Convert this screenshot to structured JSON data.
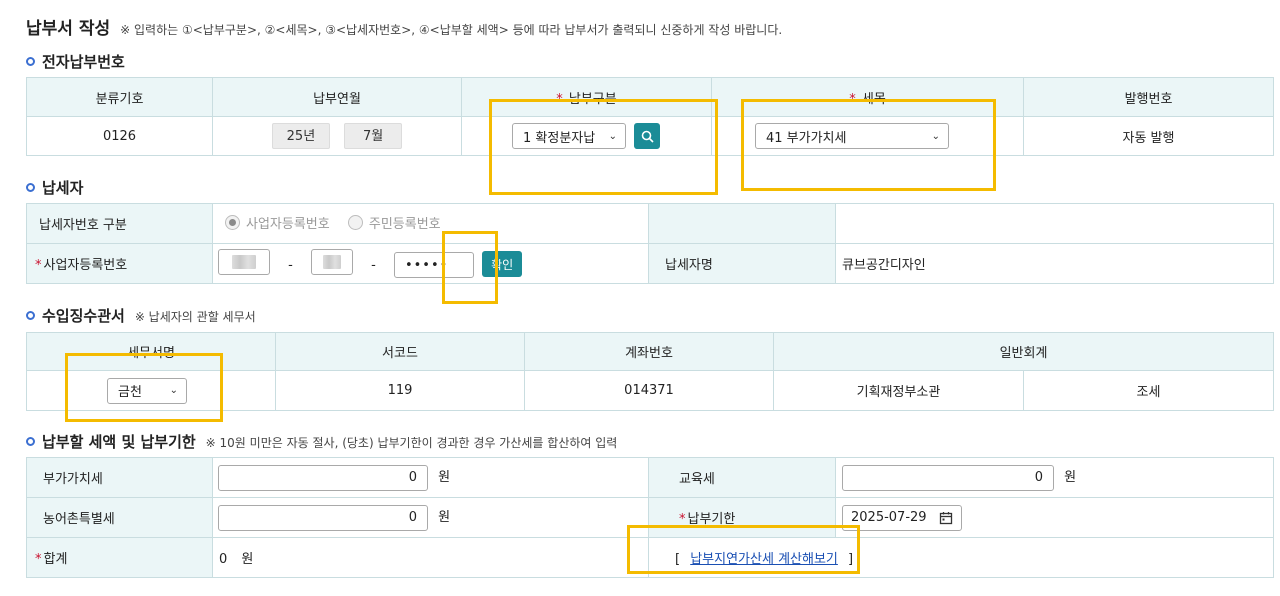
{
  "page": {
    "title": "납부서 작성",
    "note": "※ 입력하는 ①<납부구분>, ②<세목>, ③<납세자번호>, ④<납부할 세액> 등에 따라 납부서가 출력되니 신중하게 작성 바랍니다."
  },
  "electronic": {
    "section_title": "전자납부번호",
    "headers": [
      "분류기호",
      "납부연월",
      "납부구분",
      "세목",
      "발행번호"
    ],
    "class_code": "0126",
    "year": "25년",
    "month": "7월",
    "payment_type": "1 확정분자납",
    "tax_item": "41 부가가치세",
    "issue_no": "자동 발행"
  },
  "taxpayer": {
    "section_title": "납세자",
    "type_label": "납세자번호 구분",
    "radio_business": "사업자등록번호",
    "radio_resident": "주민등록번호",
    "brn_label": "사업자등록번호",
    "dash": "-",
    "masked": "•••••",
    "confirm_btn": "확인",
    "name_label": "납세자명",
    "name_value": "큐브공간디자인"
  },
  "office": {
    "section_title": "수입징수관서",
    "note": "※ 납세자의 관할 세무서",
    "headers": [
      "세무서명",
      "서코드",
      "계좌번호",
      "일반회계"
    ],
    "office_name": "금천",
    "office_code": "119",
    "account": "014371",
    "ministry": "기획재정부소관",
    "tax": "조세"
  },
  "amount": {
    "section_title": "납부할 세액 및 납부기한",
    "note": "※ 10원 미만은 자동 절사, (당초) 납부기한이 경과한 경우 가산세를 합산하여 입력",
    "vat_label": "부가가치세",
    "vat_value": "0",
    "edu_label": "교육세",
    "edu_value": "0",
    "rural_label": "농어촌특별세",
    "rural_value": "0",
    "due_label": "납부기한",
    "due_value": "2025-07-29",
    "total_label": "합계",
    "total_value": "0",
    "won": "원",
    "calc_link": "납부지연가산세 계산해보기",
    "bracket_open": "[",
    "bracket_close": "]"
  },
  "colors": {
    "accent": "#1b8c97",
    "header_bg": "#ebf6f7",
    "border": "#c9dde0",
    "highlight": "#f4bb00",
    "required": "#c8102e"
  }
}
